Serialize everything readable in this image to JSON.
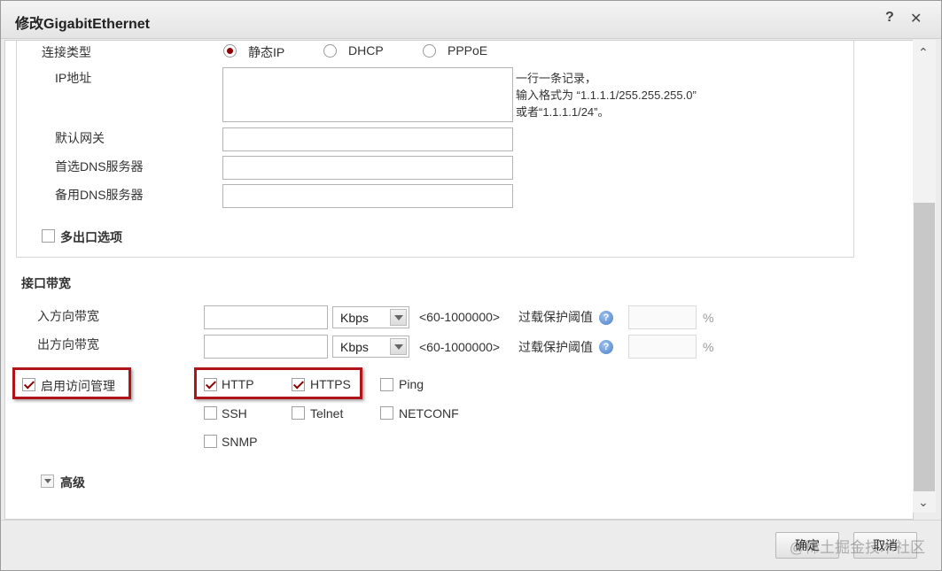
{
  "dialog": {
    "title": "修改GigabitEthernet",
    "help_glyph": "?",
    "close_glyph": "✕"
  },
  "connection": {
    "type_label": "连接类型",
    "options": [
      "静态IP",
      "DHCP",
      "PPPoE"
    ],
    "selected": "静态IP",
    "ip_label": "IP地址",
    "ip_hint": [
      "一行一条记录，",
      "输入格式为 “1.1.1.1/255.255.255.0”",
      "或者“1.1.1.1/24”。"
    ],
    "gateway_label": "默认网关",
    "dns1_label": "首选DNS服务器",
    "dns2_label": "备用DNS服务器",
    "multi_exit_label": "多出口选项"
  },
  "bandwidth": {
    "section_title": "接口带宽",
    "in_label": "入方向带宽",
    "out_label": "出方向带宽",
    "unit": "Kbps",
    "range": "<60-1000000>",
    "overload_label": "过载保护阈值",
    "percent": "%"
  },
  "access": {
    "enable_label": "启用访问管理",
    "enabled": true,
    "protocols": {
      "http": "HTTP",
      "https": "HTTPS",
      "ping": "Ping",
      "ssh": "SSH",
      "telnet": "Telnet",
      "netconf": "NETCONF",
      "snmp": "SNMP"
    },
    "checked": [
      "HTTP",
      "HTTPS"
    ]
  },
  "advanced": {
    "label": "高级"
  },
  "footer": {
    "ok_label": "确定",
    "cancel_label": "取消",
    "watermark": "@稀土掘金技术社区"
  },
  "colors": {
    "accent": "#8b0000",
    "highlight_border": "#b0141a"
  }
}
